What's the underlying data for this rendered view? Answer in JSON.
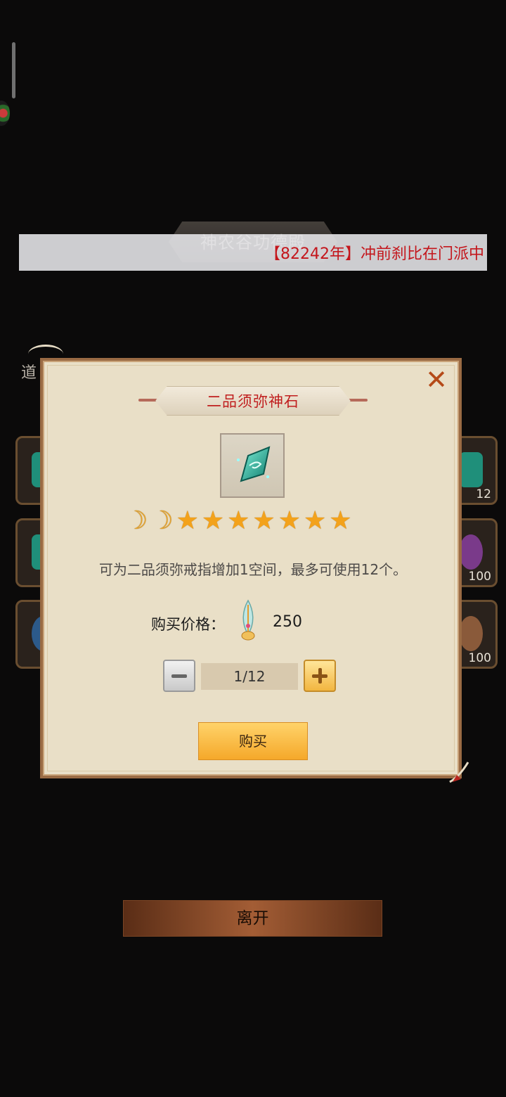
{
  "background": {
    "hall_title": "神农谷功德殿",
    "side_label": "道",
    "slot_counts": [
      "12",
      "100",
      "100"
    ],
    "leave_label": "离开"
  },
  "marquee": {
    "bracket_open": "【",
    "year": "82242年",
    "bracket_close": "】",
    "text": "冲前刹比在门派中"
  },
  "dialog": {
    "close_symbol": "✕",
    "item_name": "二品须弥神石",
    "rating": {
      "moons": 2,
      "stars": 7
    },
    "description": "可为二品须弥戒指增加1空间，最多可使用12个。",
    "price_label": "购买价格：",
    "price_value": "250",
    "quantity": "1/12",
    "buy_label": "购买"
  },
  "colors": {
    "marquee_text": "#c4161c",
    "item_name": "#c01e1e",
    "star": "#f3a21b",
    "modal_bg": "#e9dfc7"
  },
  "icons": [
    "gem-icon",
    "currency-feather-icon",
    "minus-icon",
    "plus-icon",
    "close-icon",
    "moon-icon",
    "star-icon"
  ]
}
